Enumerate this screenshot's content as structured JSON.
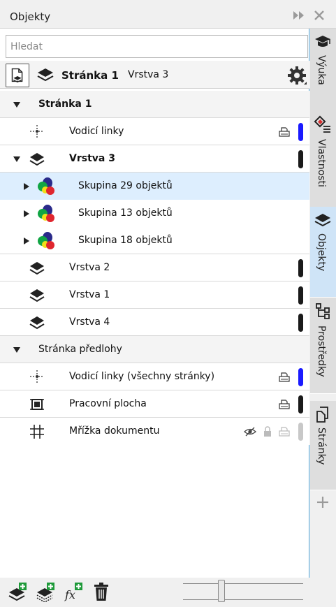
{
  "window": {
    "title": "Objekty"
  },
  "search": {
    "placeholder": "Hledat"
  },
  "context": {
    "page_label": "Stránka 1",
    "layer_label": "Vrstva 3"
  },
  "tree": {
    "page": "Stránka 1",
    "page_guides": "Vodicí linky",
    "layer3": "Vrstva 3",
    "groups": [
      "Skupina 29 objektů",
      "Skupina 13 objektů",
      "Skupina 18 objektů"
    ],
    "layer2": "Vrstva 2",
    "layer1": "Vrstva 1",
    "layer4": "Vrstva 4",
    "master": "Stránka předlohy",
    "master_guides": "Vodicí linky (všechny stránky)",
    "desktop": "Pracovní plocha",
    "grid": "Mřížka dokumentu"
  },
  "tabs": [
    "Výuka",
    "Vlastnosti",
    "Objekty",
    "Prostředky",
    "Stránky"
  ],
  "colors": {
    "accent": "#4aa3d8",
    "selection": "#ddeefe",
    "guide_layer": "#1a1aff",
    "layer_color": "#1a1a1a",
    "grid_layer": "#c8c8c8"
  },
  "icons": {
    "collapse": "double-chevron-right-icon",
    "close": "close-icon",
    "settings": "gear-icon",
    "new_layer": "new-layer-icon",
    "new_master_layer": "new-master-layer-icon",
    "new_effect": "fx-icon",
    "delete": "trash-icon"
  }
}
